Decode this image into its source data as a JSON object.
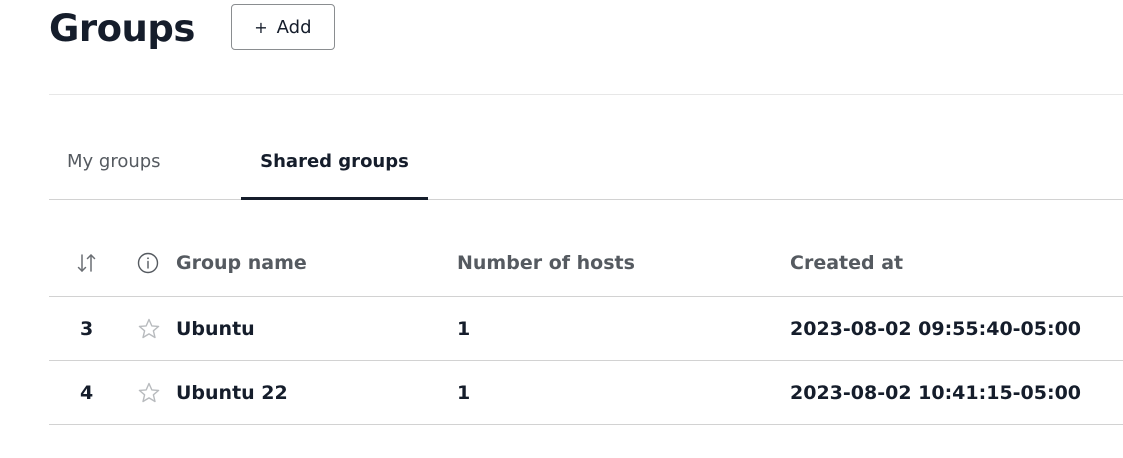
{
  "header": {
    "title": "Groups",
    "add_label": "Add",
    "add_icon": "plus-icon"
  },
  "tabs": [
    {
      "label": "My groups",
      "active": false
    },
    {
      "label": "Shared groups",
      "active": true
    }
  ],
  "table": {
    "columns": {
      "sort_icon": "sort-icon",
      "info_icon": "info-icon",
      "group_name": "Group name",
      "number_of_hosts": "Number of hosts",
      "created_at": "Created at"
    },
    "rows": [
      {
        "id": "3",
        "favorite_icon": "star-outline-icon",
        "group_name": "Ubuntu",
        "number_of_hosts": "1",
        "created_at": "2023-08-02 09:55:40-05:00"
      },
      {
        "id": "4",
        "favorite_icon": "star-outline-icon",
        "group_name": "Ubuntu 22",
        "number_of_hosts": "1",
        "created_at": "2023-08-02 10:41:15-05:00"
      }
    ]
  },
  "colors": {
    "text_primary": "#151d2b",
    "text_secondary": "#555a60",
    "link": "#4d6aae",
    "border": "#d2d2d2"
  }
}
